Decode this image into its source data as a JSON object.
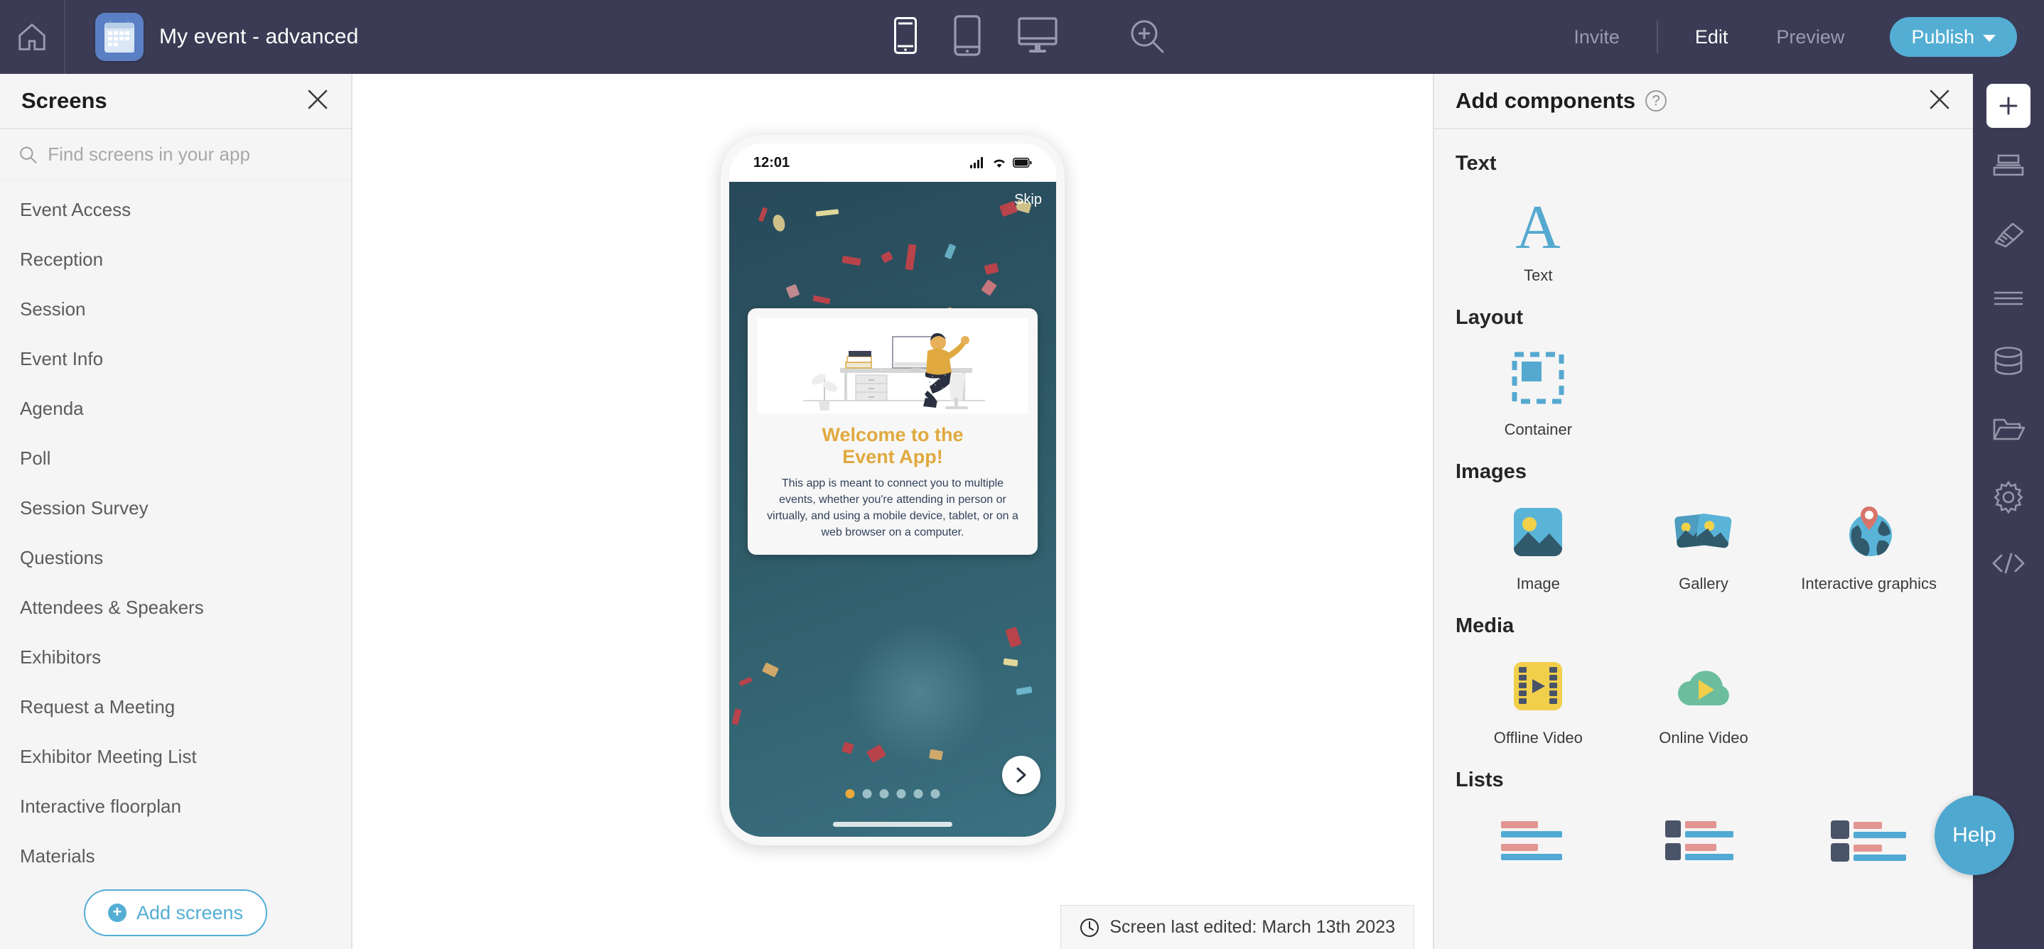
{
  "topbar": {
    "home_icon": "home-icon",
    "app_icon": "calendar-icon",
    "title": "My event - advanced",
    "devices": [
      {
        "name": "mobile",
        "label": "Mobile",
        "active": true
      },
      {
        "name": "tablet",
        "label": "Tablet",
        "active": false
      },
      {
        "name": "desktop",
        "label": "Desktop",
        "active": false
      }
    ],
    "zoom_icon": "zoom-in-icon",
    "invite_label": "Invite",
    "edit_label": "Edit",
    "preview_label": "Preview",
    "publish_label": "Publish"
  },
  "sidebar": {
    "title": "Screens",
    "close_icon": "close-icon",
    "search_placeholder": "Find screens in your app",
    "search_value": "",
    "items": [
      {
        "label": "Event Access"
      },
      {
        "label": "Reception"
      },
      {
        "label": "Session"
      },
      {
        "label": "Event Info"
      },
      {
        "label": "Agenda"
      },
      {
        "label": "Poll"
      },
      {
        "label": "Session Survey"
      },
      {
        "label": "Questions"
      },
      {
        "label": "Attendees & Speakers"
      },
      {
        "label": "Exhibitors"
      },
      {
        "label": "Request a Meeting"
      },
      {
        "label": "Exhibitor Meeting List"
      },
      {
        "label": "Interactive floorplan"
      },
      {
        "label": "Materials"
      }
    ],
    "add_screens_label": "Add screens"
  },
  "canvas": {
    "phone": {
      "status_time": "12:01",
      "skip_label": "Skip",
      "card_title_line1": "Welcome to the",
      "card_title_line2": "Event App!",
      "card_body": "This app is meant to connect you to multiple events, whether you're attending in person or virtually, and using a mobile device, tablet, or on a web browser on a computer.",
      "dots_total": 6,
      "dots_active_index": 0,
      "next_icon": "chevron-right-icon"
    },
    "last_edited": "Screen last edited: March 13th 2023",
    "last_edited_icon": "clock-icon"
  },
  "right_panel": {
    "title": "Add components",
    "help_icon": "question-mark-icon",
    "close_icon": "close-icon",
    "groups": [
      {
        "name": "Text",
        "components": [
          {
            "label": "Text",
            "icon": "letter-a-icon"
          }
        ]
      },
      {
        "name": "Layout",
        "components": [
          {
            "label": "Container",
            "icon": "container-icon"
          }
        ]
      },
      {
        "name": "Images",
        "components": [
          {
            "label": "Image",
            "icon": "image-icon"
          },
          {
            "label": "Gallery",
            "icon": "gallery-icon"
          },
          {
            "label": "Interactive graphics",
            "icon": "globe-pin-icon"
          }
        ]
      },
      {
        "name": "Media",
        "components": [
          {
            "label": "Offline Video",
            "icon": "film-strip-icon"
          },
          {
            "label": "Online Video",
            "icon": "cloud-play-icon"
          }
        ]
      },
      {
        "name": "Lists",
        "components": [
          {
            "label": "",
            "icon": "list-simple-icon"
          },
          {
            "label": "",
            "icon": "list-thumb-icon"
          },
          {
            "label": "",
            "icon": "list-avatar-icon"
          }
        ]
      }
    ]
  },
  "right_toolbar": {
    "add_icon": "add-plus-icon",
    "items": [
      {
        "icon": "layout-align-icon",
        "label": "Layout"
      },
      {
        "icon": "paintbrush-icon",
        "label": "Design"
      },
      {
        "icon": "menu-lines-icon",
        "label": "Menu"
      },
      {
        "icon": "database-icon",
        "label": "Data"
      },
      {
        "icon": "folder-icon",
        "label": "Files"
      },
      {
        "icon": "gear-icon",
        "label": "Settings"
      },
      {
        "icon": "code-icon",
        "label": "Code"
      }
    ]
  },
  "help": {
    "label": "Help"
  },
  "colors": {
    "topbar_bg": "#3b3b55",
    "accent": "#54aed4",
    "panel_bg": "#f5f5f5",
    "gold": "#e0a93f",
    "phone_screen": "#2c5361"
  }
}
